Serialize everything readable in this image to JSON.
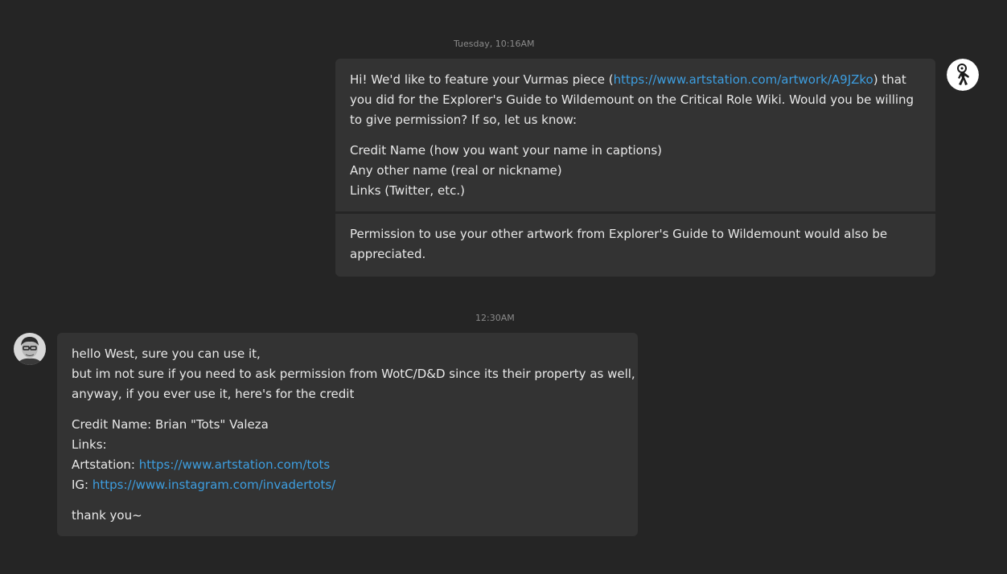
{
  "thread": {
    "outgoing": {
      "timestamp": "Tuesday, 10:16AM",
      "msg1": {
        "intro_before_link": "Hi! We'd like to feature your Vurmas piece (",
        "link": "https://www.artstation.com/artwork/A9JZko",
        "intro_after_link": ") that you did for the Explorer's Guide to Wildemount on the Critical Role Wiki. Would you be willing to give permission? If so, let us know:",
        "list": [
          "Credit Name (how you want your name in captions)",
          "Any other name (real or nickname)",
          "Links (Twitter, etc.)"
        ]
      },
      "msg2": {
        "text": "Permission to use your other artwork from Explorer's Guide to Wildemount would also be appreciated."
      }
    },
    "incoming": {
      "timestamp": "12:30AM",
      "lines": [
        "hello West, sure you can use it,",
        "but im not sure if you need to ask permission from WotC/D&D since its their property as well,",
        "anyway, if you ever use it, here's for the credit"
      ],
      "credit_name": "Credit Name: Brian \"Tots\" Valeza",
      "links_label": "Links:",
      "artstation_label": "Artstation: ",
      "artstation_link": "https://www.artstation.com/tots",
      "ig_label": "IG: ",
      "ig_link": "https://www.instagram.com/invadertots/",
      "closing": "thank you~"
    }
  },
  "icons": {
    "own_avatar": "explorer-figure-icon",
    "other_avatar": "user-photo-avatar"
  },
  "colors": {
    "background": "#252525",
    "bubble": "#333333",
    "text": "#e8e8e8",
    "link": "#3d9ee0",
    "timestamp": "#8a8a8a"
  }
}
